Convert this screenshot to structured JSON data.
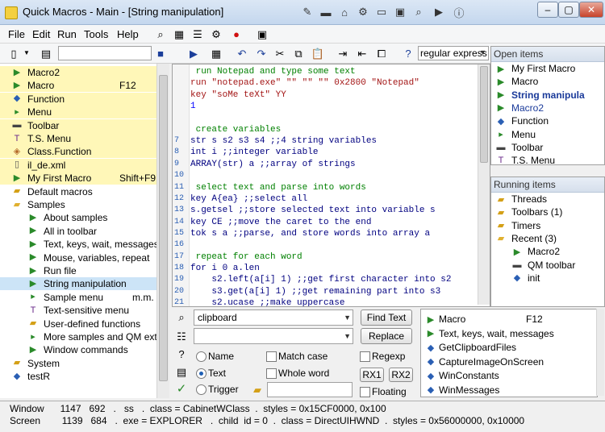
{
  "window": {
    "title": "Quick Macros - Main - [String manipulation]"
  },
  "menu": [
    "File",
    "Edit",
    "Run",
    "Tools",
    "Help"
  ],
  "toolbar": {
    "search_combo": "regular express"
  },
  "tree": [
    {
      "label": "Macro2",
      "icon": "macro-icon",
      "hl": true
    },
    {
      "label": "Macro",
      "key": "F12",
      "icon": "macro-icon",
      "hl": true
    },
    {
      "label": "Function",
      "icon": "function-icon",
      "hl": true
    },
    {
      "label": "Menu",
      "icon": "menu-icon",
      "hl": true
    },
    {
      "label": "Toolbar",
      "icon": "toolbar-icon",
      "hl": true
    },
    {
      "label": "T.S. Menu",
      "icon": "ts-menu-icon",
      "hl": true
    },
    {
      "label": "Class.Function",
      "icon": "class-function-icon",
      "hl": true
    },
    {
      "label": "il_de.xml",
      "icon": "file-icon",
      "hl": true
    },
    {
      "label": "My First Macro",
      "key": "Shift+F9",
      "icon": "macro-icon",
      "hl": true
    },
    {
      "label": "Default macros",
      "icon": "folder-icon",
      "indent": 1
    },
    {
      "label": "Samples",
      "icon": "folder-open-icon",
      "indent": 1
    },
    {
      "label": "About samples",
      "icon": "macro-icon",
      "indent": 2
    },
    {
      "label": "All in toolbar",
      "icon": "macro-icon",
      "indent": 2
    },
    {
      "label": "Text, keys, wait, messages",
      "icon": "macro-icon",
      "indent": 2
    },
    {
      "label": "Mouse, variables, repeat",
      "icon": "macro-icon",
      "indent": 2
    },
    {
      "label": "Run file",
      "icon": "macro-icon",
      "indent": 2
    },
    {
      "label": "String manipulation",
      "icon": "macro-icon",
      "indent": 2,
      "sel": true
    },
    {
      "label": "Sample menu",
      "key": "m.m. i",
      "icon": "menu-icon",
      "indent": 2
    },
    {
      "label": "Text-sensitive menu",
      "icon": "ts-menu-icon",
      "indent": 2
    },
    {
      "label": "User-defined functions",
      "icon": "folder-icon",
      "indent": 2
    },
    {
      "label": "More samples and QM extens",
      "icon": "menu-icon",
      "indent": 2
    },
    {
      "label": "Window commands",
      "icon": "macro-icon",
      "indent": 2
    },
    {
      "label": "System",
      "icon": "folder-icon",
      "indent": 1
    },
    {
      "label": "testR",
      "icon": "function-icon",
      "indent": 1
    }
  ],
  "code": [
    {
      "n": "",
      "t": " run Notepad and type some text",
      "c": "comment"
    },
    {
      "n": "",
      "t": "run \"notepad.exe\" \"\" \"\" \"\" 0x2800 \"Notepad\"",
      "c": "run"
    },
    {
      "n": "",
      "t": "key \"soMe teXt\" YY",
      "c": "key"
    },
    {
      "n": "",
      "t": "1",
      "c": "num"
    },
    {
      "n": "",
      "t": "",
      "c": "plain"
    },
    {
      "n": "",
      "t": " create variables",
      "c": "comment"
    },
    {
      "n": "7",
      "t": "str s s2 s3 s4 ;;4 string variables",
      "c": "decl"
    },
    {
      "n": "8",
      "t": "int i ;;integer variable",
      "c": "decl"
    },
    {
      "n": "9",
      "t": "ARRAY(str) a ;;array of strings",
      "c": "decl"
    },
    {
      "n": "10",
      "t": "",
      "c": "plain"
    },
    {
      "n": "11",
      "t": " select text and parse into words",
      "c": "comment"
    },
    {
      "n": "12",
      "t": "key A{ea} ;;select all",
      "c": "decl"
    },
    {
      "n": "13",
      "t": "s.getsel ;;store selected text into variable s",
      "c": "decl"
    },
    {
      "n": "14",
      "t": "key CE ;;move the caret to the end",
      "c": "decl"
    },
    {
      "n": "15",
      "t": "tok s a ;;parse, and store words into array a",
      "c": "decl"
    },
    {
      "n": "16",
      "t": "",
      "c": "plain"
    },
    {
      "n": "17",
      "t": " repeat for each word",
      "c": "comment"
    },
    {
      "n": "18",
      "t": "for i 0 a.len",
      "c": "decl"
    },
    {
      "n": "19",
      "t": "    s2.left(a[i] 1) ;;get first character into s2",
      "c": "decl"
    },
    {
      "n": "20",
      "t": "    s3.get(a[i] 1) ;;get remaining part into s3",
      "c": "decl"
    },
    {
      "n": "21",
      "t": "    s2.ucase ;;make uppercase",
      "c": "decl"
    }
  ],
  "open_items": {
    "title": "Open items",
    "items": [
      {
        "label": "My First Macro",
        "icon": "macro-icon"
      },
      {
        "label": "Macro",
        "icon": "macro-icon"
      },
      {
        "label": "String manipula",
        "icon": "macro-icon",
        "bold": true
      },
      {
        "label": "Macro2",
        "icon": "macro-icon",
        "blue": true
      },
      {
        "label": "Function",
        "icon": "function-icon"
      },
      {
        "label": "Menu",
        "icon": "menu-icon"
      },
      {
        "label": "Toolbar",
        "icon": "toolbar-icon"
      },
      {
        "label": "T.S. Menu",
        "icon": "ts-menu-icon"
      }
    ]
  },
  "running_items": {
    "title": "Running items",
    "items": [
      {
        "label": "Threads",
        "icon": "folder-icon",
        "indent": 0
      },
      {
        "label": "Toolbars (1)",
        "icon": "folder-icon",
        "indent": 0
      },
      {
        "label": "Timers",
        "icon": "folder-icon",
        "indent": 0
      },
      {
        "label": "Recent (3)",
        "icon": "folder-open-icon",
        "indent": 0
      },
      {
        "label": "Macro2",
        "icon": "macro-icon",
        "indent": 1
      },
      {
        "label": "QM toolbar",
        "icon": "toolbar-icon",
        "indent": 1
      },
      {
        "label": "init",
        "icon": "function-icon",
        "indent": 1
      }
    ]
  },
  "find": {
    "query": "clipboard",
    "replace": "",
    "find_btn": "Find Text",
    "replace_btn": "Replace",
    "radio_name": "Name",
    "radio_text": "Text",
    "radio_trigger": "Trigger",
    "match_case": "Match case",
    "whole_word": "Whole word",
    "regexp": "Regexp",
    "floating": "Floating",
    "rx1": "RX1",
    "rx2": "RX2"
  },
  "results": [
    {
      "label": "Macro",
      "key": "F12",
      "icon": "macro-icon"
    },
    {
      "label": "Text, keys, wait, messages",
      "icon": "macro-icon"
    },
    {
      "label": "GetClipboardFiles",
      "icon": "function-icon"
    },
    {
      "label": "CaptureImageOnScreen",
      "icon": "function-icon"
    },
    {
      "label": "WinConstants",
      "icon": "function-icon"
    },
    {
      "label": "WinMessages",
      "icon": "function-icon"
    }
  ],
  "status": {
    "line1": "Window      1147   692   .   ss   .  class = CabinetWClass  .  styles = 0x15CF0000, 0x100",
    "line2": "Screen        1139   684   .  exe = EXPLORER   .  child  id = 0  .  class = DirectUIHWND  .  styles = 0x56000000, 0x10000"
  },
  "colors": {
    "comment": "#008000",
    "run": "#a31515",
    "keyword": "#0000ff",
    "decl": "#000080",
    "highlight": "#fff7b8",
    "select": "#cce4f7"
  }
}
